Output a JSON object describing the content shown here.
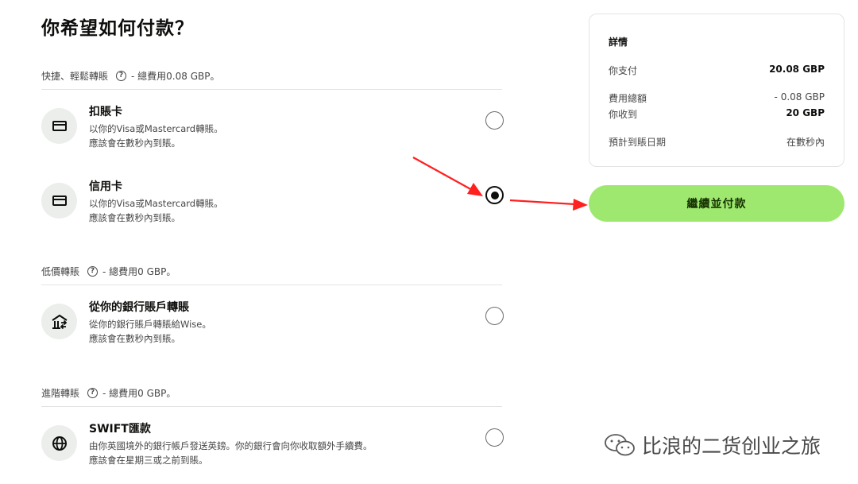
{
  "page": {
    "title": "你希望如何付款？"
  },
  "sections": [
    {
      "header": "快捷、輕鬆轉賬",
      "fee": "- 總費用0.08 GBP。",
      "options": [
        {
          "title": "扣賬卡",
          "desc1": "以你的Visa或Mastercard轉賬。",
          "desc2": "應該會在數秒內到賬。",
          "icon": "card-icon",
          "selected": false
        },
        {
          "title": "信用卡",
          "desc1": "以你的Visa或Mastercard轉賬。",
          "desc2": "應該會在數秒內到賬。",
          "icon": "card-icon",
          "selected": true
        }
      ]
    },
    {
      "header": "低價轉賬",
      "fee": "- 總費用0 GBP。",
      "options": [
        {
          "title": "從你的銀行賬戶轉賬",
          "desc1": "從你的銀行賬戶轉賬給Wise。",
          "desc2": "應該會在數秒內到賬。",
          "icon": "bank-icon",
          "selected": false
        }
      ]
    },
    {
      "header": "進階轉賬",
      "fee": "- 總費用0 GBP。",
      "options": [
        {
          "title": "SWIFT匯款",
          "desc1": "由你英國境外的銀行帳戶發送英鎊。你的銀行會向你收取額外手續費。",
          "desc2": "應該會在星期三或之前到賬。",
          "icon": "globe-icon",
          "selected": false
        }
      ]
    }
  ],
  "details": {
    "title": "詳情",
    "you_pay_label": "你支付",
    "you_pay_value": "20.08 GBP",
    "fees_label": "費用總額",
    "fees_value": "- 0.08 GBP",
    "receive_label": "你收到",
    "receive_value": "20 GBP",
    "arrival_label": "預計到賬日期",
    "arrival_value": "在數秒內"
  },
  "continue_button": "繼續並付款",
  "watermark": "比浪的二货创业之旅",
  "colors": {
    "accent": "#9fe870",
    "arrow": "#ff2020"
  }
}
